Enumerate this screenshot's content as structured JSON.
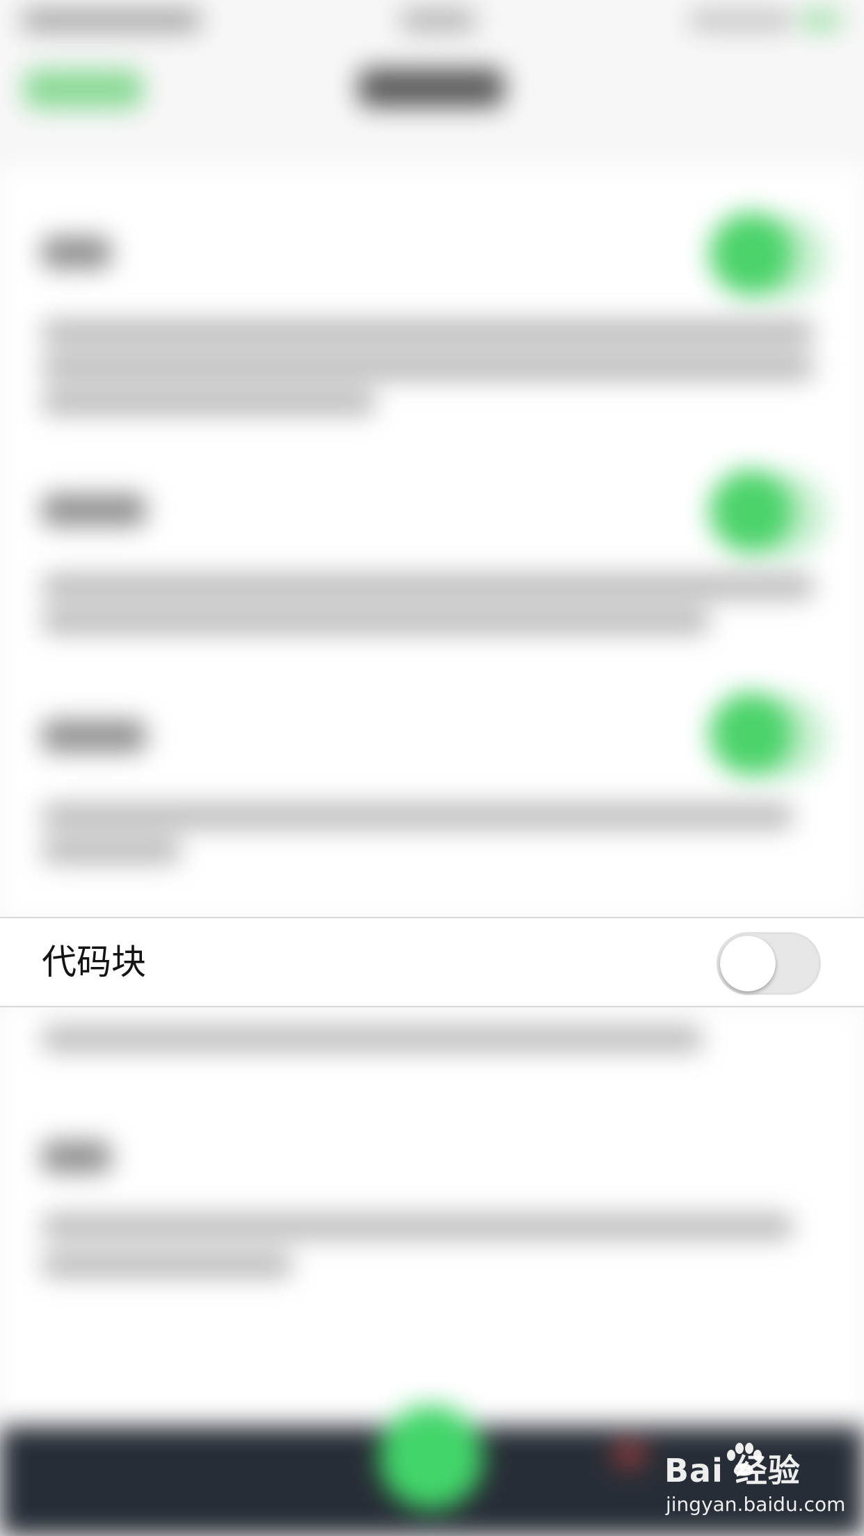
{
  "setting_row": {
    "label": "代码块",
    "toggle_on": false
  },
  "watermark": {
    "brand": "Bai  经验",
    "url": "jingyan.baidu.com"
  },
  "colors": {
    "accent_green": "#4cd36a",
    "bottom_bar": "#272d36",
    "switch_off_track": "#e6e6e6"
  }
}
